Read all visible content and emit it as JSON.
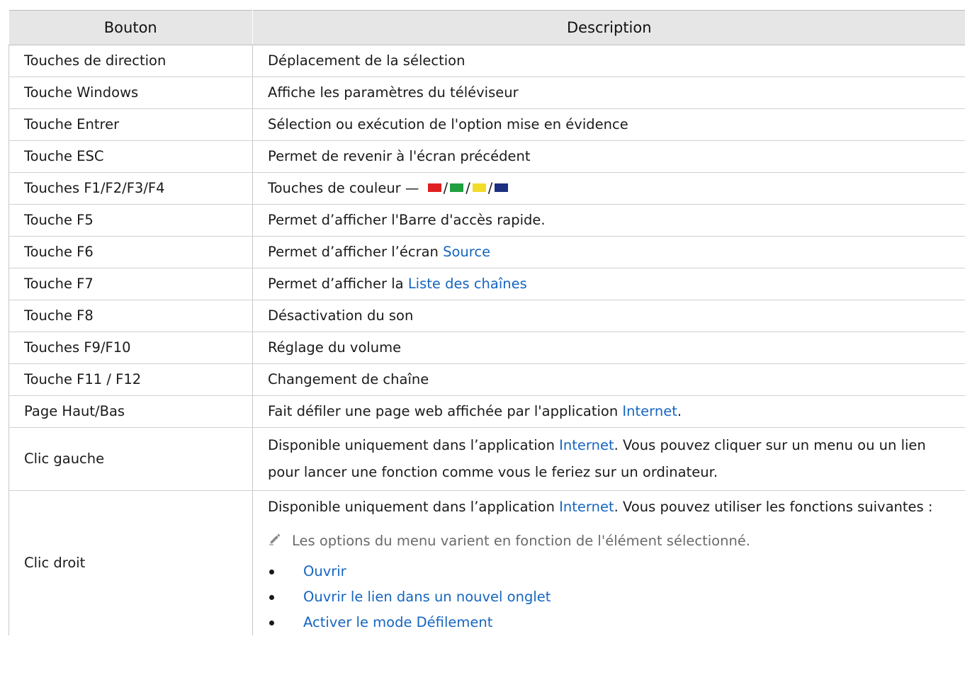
{
  "table": {
    "headers": {
      "button": "Bouton",
      "description": "Description"
    },
    "rows": [
      {
        "button": "Touches de direction",
        "text": "Déplacement de la sélection"
      },
      {
        "button": "Touche Windows",
        "text": "Affiche les paramètres du téléviseur"
      },
      {
        "button": "Touche Entrer",
        "text": "Sélection ou exécution de l'option mise en évidence"
      },
      {
        "button": "Touche ESC",
        "text": "Permet de revenir à l'écran précédent"
      },
      {
        "button": "Touches F1/F2/F3/F4",
        "text": "Touches de couleur —",
        "sep": "/"
      },
      {
        "button": "Touche F5",
        "text": "Permet d’afficher l'Barre d'accès rapide."
      },
      {
        "button": "Touche F6",
        "text": "Permet d’afficher l’écran ",
        "link": "Source"
      },
      {
        "button": "Touche F7",
        "text": "Permet d’afficher la ",
        "link": "Liste des chaînes"
      },
      {
        "button": "Touche F8",
        "text": "Désactivation du son"
      },
      {
        "button": "Touches F9/F10",
        "text": "Réglage du volume"
      },
      {
        "button": "Touche F11 / F12",
        "text": "Changement de chaîne"
      },
      {
        "button": "Page Haut/Bas",
        "text": "Fait défiler une page web affichée par l'application ",
        "link": "Internet",
        "after": "."
      },
      {
        "button": "Clic gauche",
        "text": "Disponible uniquement dans l’application ",
        "link": "Internet",
        "after": ". Vous pouvez cliquer sur un menu ou un lien pour lancer une fonction comme vous le feriez sur un ordinateur."
      },
      {
        "button": "Clic droit",
        "text": "Disponible uniquement dans l’application ",
        "link": "Internet",
        "after": ". Vous pouvez utiliser les fonctions suivantes :",
        "note": "Les options du menu varient en fonction de l'élément sélectionné.",
        "options": [
          "Ouvrir",
          "Ouvrir le lien dans un nouvel onglet",
          "Activer le mode Défilement"
        ]
      }
    ]
  },
  "colors": {
    "link": "#1565c0",
    "red": "#e02020",
    "green": "#1fa040",
    "yellow": "#f2dc2a",
    "blue": "#1c2f80",
    "header_bg": "#e6e6e6",
    "note_text": "#6a6a6a"
  },
  "icons": {
    "note": "pencil-icon"
  }
}
